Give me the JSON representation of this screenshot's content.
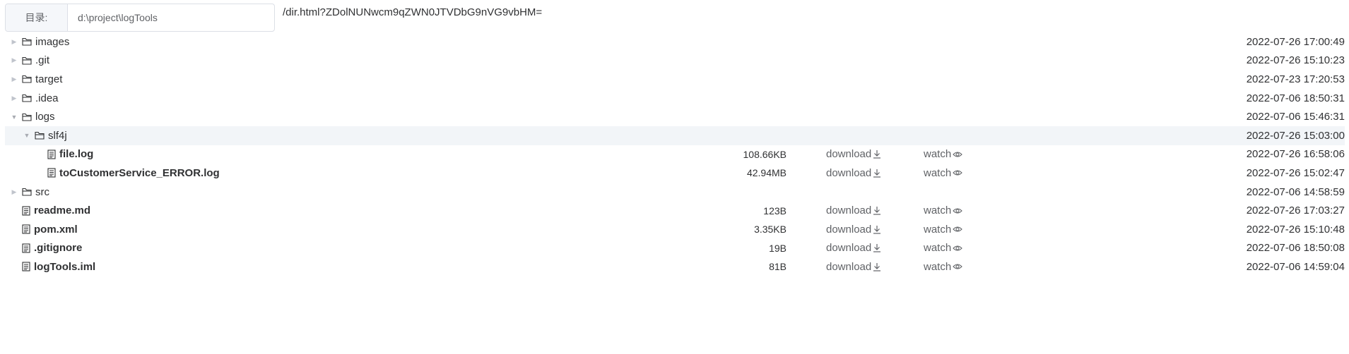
{
  "dir": {
    "label": "目录:",
    "value": "d:\\project\\logTools",
    "url": "/dir.html?ZDolNUNwcm9qZWN0JTVDbG9nVG9vbHM="
  },
  "rows": [
    {
      "name": "images",
      "type": "folder",
      "caret": "collapsed",
      "depth": 0,
      "time": "2022-07-26 17:00:49"
    },
    {
      "name": ".git",
      "type": "folder",
      "caret": "collapsed",
      "depth": 0,
      "time": "2022-07-26 15:10:23"
    },
    {
      "name": "target",
      "type": "folder",
      "caret": "collapsed",
      "depth": 0,
      "time": "2022-07-23 17:20:53"
    },
    {
      "name": ".idea",
      "type": "folder",
      "caret": "collapsed",
      "depth": 0,
      "time": "2022-07-06 18:50:31"
    },
    {
      "name": "logs",
      "type": "folder",
      "caret": "expanded",
      "depth": 0,
      "time": "2022-07-06 15:46:31"
    },
    {
      "name": "slf4j",
      "type": "folder",
      "caret": "expanded",
      "depth": 1,
      "time": "2022-07-26 15:03:00",
      "highlight": true
    },
    {
      "name": "file.log",
      "type": "file",
      "depth": 2,
      "size": "108.66KB",
      "download": "download",
      "watch": "watch",
      "time": "2022-07-26 16:58:06"
    },
    {
      "name": "toCustomerService_ERROR.log",
      "type": "file",
      "depth": 2,
      "size": "42.94MB",
      "download": "download",
      "watch": "watch",
      "time": "2022-07-26 15:02:47"
    },
    {
      "name": "src",
      "type": "folder",
      "caret": "collapsed",
      "depth": 0,
      "time": "2022-07-06 14:58:59"
    },
    {
      "name": "readme.md",
      "type": "file",
      "depth": 0,
      "size": "123B",
      "download": "download",
      "watch": "watch",
      "time": "2022-07-26 17:03:27"
    },
    {
      "name": "pom.xml",
      "type": "file",
      "depth": 0,
      "size": "3.35KB",
      "download": "download",
      "watch": "watch",
      "time": "2022-07-26 15:10:48"
    },
    {
      "name": ".gitignore",
      "type": "file",
      "depth": 0,
      "size": "19B",
      "download": "download",
      "watch": "watch",
      "time": "2022-07-06 18:50:08"
    },
    {
      "name": "logTools.iml",
      "type": "file",
      "depth": 0,
      "size": "81B",
      "download": "download",
      "watch": "watch",
      "time": "2022-07-06 14:59:04"
    }
  ]
}
